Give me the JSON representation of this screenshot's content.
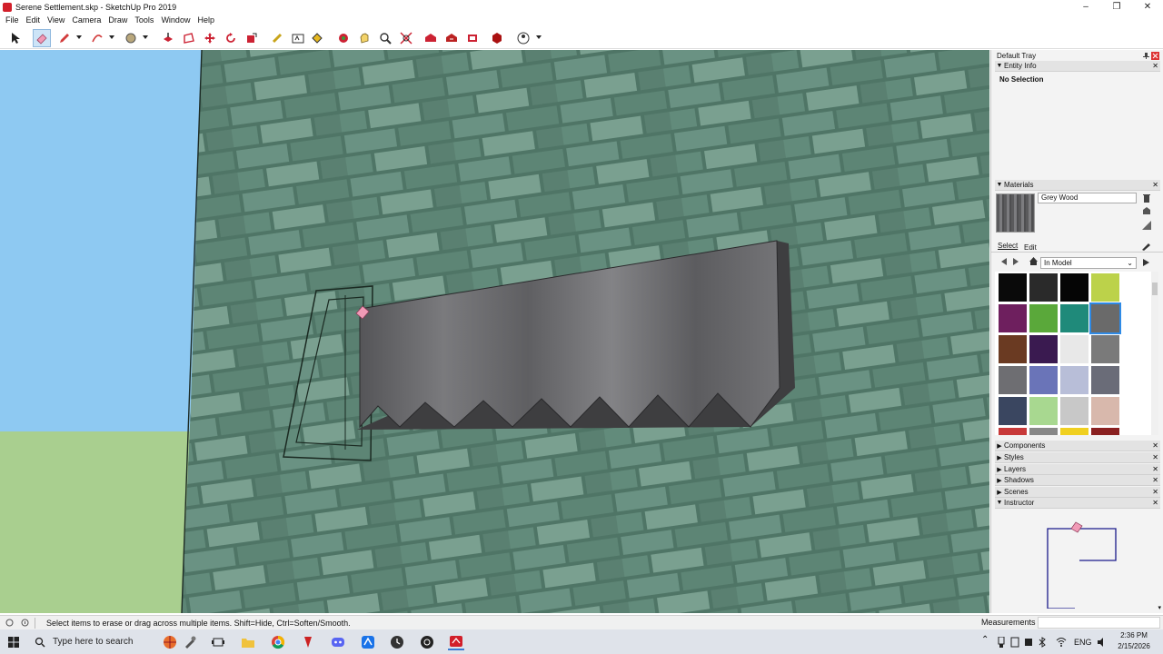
{
  "window": {
    "title": "Serene Settlement.skp - SketchUp Pro 2019",
    "minimize": "–",
    "maximize": "❐",
    "close": "✕"
  },
  "menu": [
    "File",
    "Edit",
    "View",
    "Camera",
    "Draw",
    "Tools",
    "Window",
    "Help"
  ],
  "toolbar": {
    "tools": [
      "select-tool",
      "eraser-tool",
      "pencil-tool",
      "arc-tool",
      "shapes-tool",
      "push-pull-tool",
      "offset-tool",
      "move-tool",
      "rotate-tool",
      "scale-tool",
      "tape-measure-tool",
      "text-tool",
      "paint-bucket-tool",
      "orbit-tool",
      "pan-tool",
      "zoom-tool",
      "zoom-extents-tool",
      "warehouse-tool",
      "extension-warehouse-tool",
      "layout-tool",
      "extension-manager-tool",
      "account-tool"
    ],
    "active": "eraser-tool"
  },
  "tray": {
    "title": "Default Tray",
    "entity_info": {
      "title": "Entity Info",
      "value": "No Selection"
    },
    "materials": {
      "title": "Materials",
      "name_value": "Grey Wood",
      "tab_select": "Select",
      "tab_edit": "Edit",
      "collection": "In Model",
      "swatch_colors": [
        "#0a0a0a",
        "#2a2a2a",
        "#050505",
        "#bcd24a",
        "#6e1f5e",
        "#5aa83a",
        "#1f8a7a",
        "#6a6a6a",
        "#6a3a22",
        "#3a1a50",
        "#e8e8e8",
        "#7a7a7a",
        "#6e6e72",
        "#6a74b8",
        "#b8bed8",
        "#6a6c78",
        "#3a4660",
        "#a8d890",
        "#c8c8c8",
        "#d8b8ac",
        "#c83a3a",
        "#888888",
        "#f0d020",
        "#8a2020"
      ]
    },
    "collapsed_panels": [
      "Components",
      "Styles",
      "Layers",
      "Shadows",
      "Scenes"
    ],
    "instructor": {
      "title": "Instructor"
    }
  },
  "status": {
    "hint": "Select items to erase or drag across multiple items. Shift=Hide, Ctrl=Soften/Smooth.",
    "measurements_label": "Measurements",
    "measurements_value": ""
  },
  "taskbar": {
    "search_placeholder": "Type here to search",
    "tray_lang": "ENG",
    "time": "2:36 PM",
    "date": "2/15/2026"
  },
  "colors": {
    "sky": "#8ec9f2",
    "ground": "#a9cf8f",
    "brick_wall": "#5f8677",
    "saw_material": "#6c6c6e",
    "active_tool": "#cde4f7",
    "selected_swatch_border": "#2e8ae6"
  }
}
